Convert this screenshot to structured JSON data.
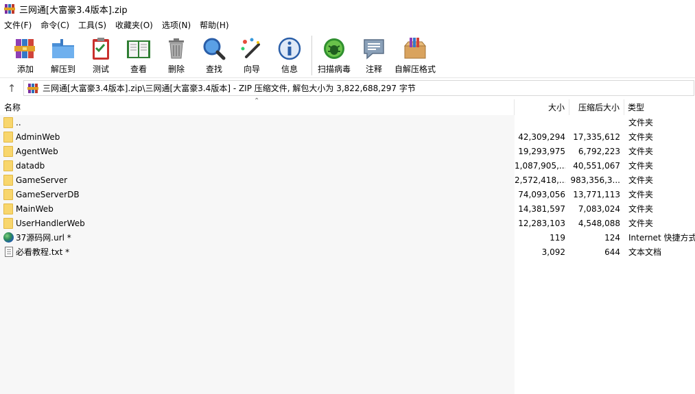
{
  "window": {
    "title": "三网通[大富豪3.4版本].zip"
  },
  "menu": [
    "文件(F)",
    "命令(C)",
    "工具(S)",
    "收藏夹(O)",
    "选项(N)",
    "帮助(H)"
  ],
  "toolbar": {
    "add": "添加",
    "extract_to": "解压到",
    "test": "测试",
    "view": "查看",
    "delete": "删除",
    "find": "查找",
    "wizard": "向导",
    "info": "信息",
    "virus_scan": "扫描病毒",
    "comment": "注释",
    "sfx": "自解压格式"
  },
  "address": {
    "path": "三网通[大富豪3.4版本].zip\\三网通[大富豪3.4版本] - ZIP 压缩文件, 解包大小为 3,822,688,297 字节"
  },
  "columns": {
    "name": "名称",
    "size": "大小",
    "packed": "压缩后大小",
    "type": "类型"
  },
  "files": [
    {
      "name": "..",
      "size": "",
      "packed": "",
      "type": "文件夹",
      "icon": "folder"
    },
    {
      "name": "AdminWeb",
      "size": "42,309,294",
      "packed": "17,335,612",
      "type": "文件夹",
      "icon": "folder"
    },
    {
      "name": "AgentWeb",
      "size": "19,293,975",
      "packed": "6,792,223",
      "type": "文件夹",
      "icon": "folder"
    },
    {
      "name": "datadb",
      "size": "1,087,905,...",
      "packed": "40,551,067",
      "type": "文件夹",
      "icon": "folder"
    },
    {
      "name": "GameServer",
      "size": "2,572,418,...",
      "packed": "983,356,3...",
      "type": "文件夹",
      "icon": "folder"
    },
    {
      "name": "GameServerDB",
      "size": "74,093,056",
      "packed": "13,771,113",
      "type": "文件夹",
      "icon": "folder"
    },
    {
      "name": "MainWeb",
      "size": "14,381,597",
      "packed": "7,083,024",
      "type": "文件夹",
      "icon": "folder"
    },
    {
      "name": "UserHandlerWeb",
      "size": "12,283,103",
      "packed": "4,548,088",
      "type": "文件夹",
      "icon": "folder"
    },
    {
      "name": "37源码网.url *",
      "size": "119",
      "packed": "124",
      "type": "Internet 快捷方式",
      "icon": "globe"
    },
    {
      "name": "必看教程.txt *",
      "size": "3,092",
      "packed": "644",
      "type": "文本文档",
      "icon": "txt"
    }
  ]
}
